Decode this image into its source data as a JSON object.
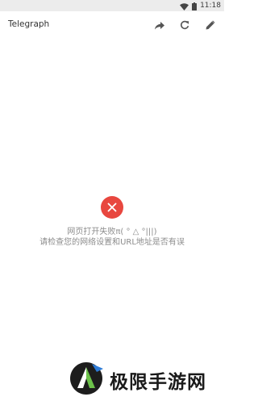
{
  "status_bar": {
    "time": "11:18",
    "icons": [
      "wifi-icon",
      "battery-icon"
    ]
  },
  "toolbar": {
    "title": "Telegraph",
    "icons": [
      "share-icon",
      "refresh-icon",
      "edit-icon"
    ]
  },
  "error": {
    "icon": "error-x-icon",
    "color": "#e8473f",
    "line1": "网页打开失败π( ° △ °|||)",
    "line2": "请检查您的网络设置和URL地址是否有误"
  },
  "watermark": {
    "text": "极限手游网"
  }
}
